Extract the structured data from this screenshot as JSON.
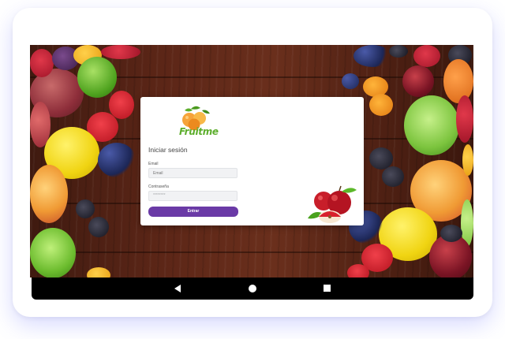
{
  "app": {
    "brand_name": "Fruitme"
  },
  "login": {
    "title": "Iniciar sesión",
    "email_label": "Email",
    "email_placeholder": "Email",
    "email_value": "",
    "password_label": "Contraseña",
    "password_value": "********",
    "submit_label": "Entrar"
  },
  "colors": {
    "accent": "#6a3aa6",
    "logo_green": "#5cae2c",
    "background_wood": "#5c2617"
  },
  "nav_bar": {
    "icons": [
      "back-icon",
      "home-icon",
      "recent-apps-icon"
    ]
  }
}
